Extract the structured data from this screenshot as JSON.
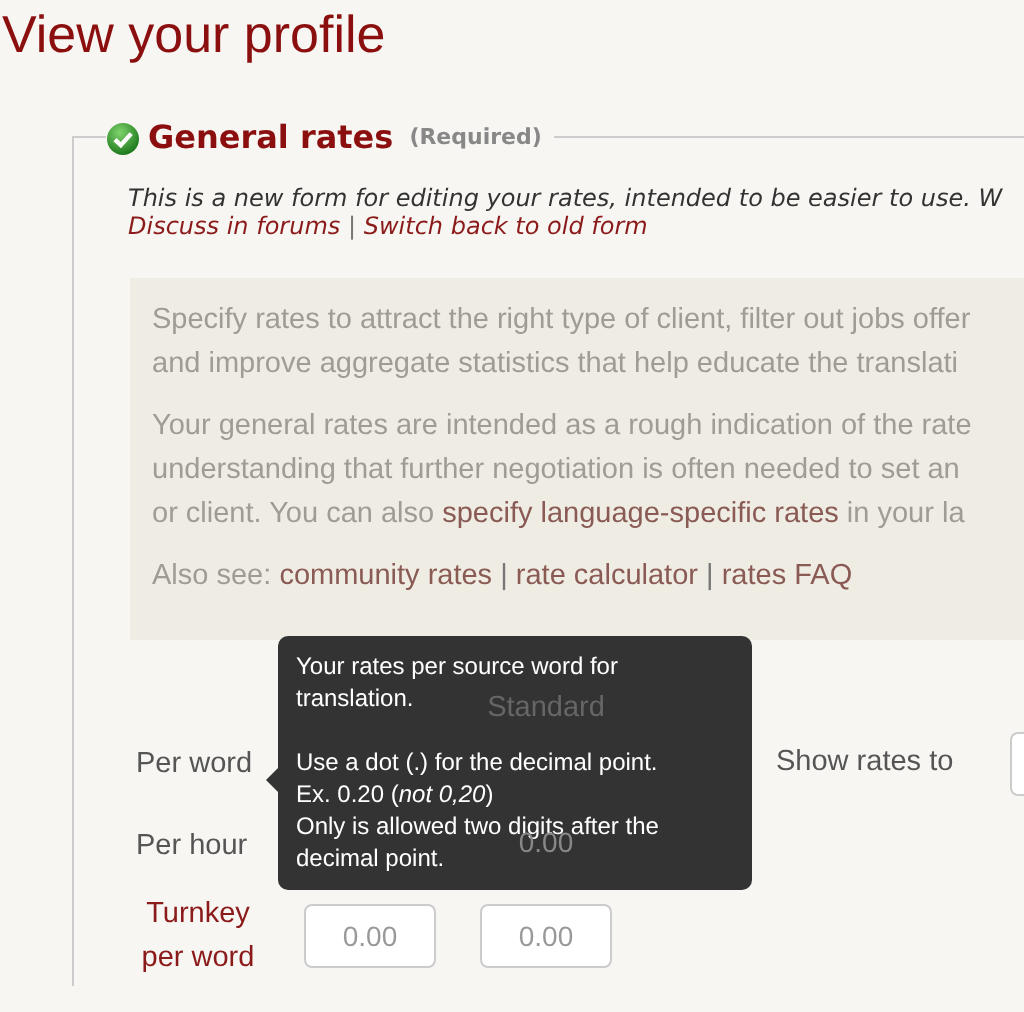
{
  "page_title": "View your profile",
  "section": {
    "title": "General rates",
    "note": "(Required)",
    "complete": true,
    "intro": "This is a new form for editing your rates, intended to be easier to use. W",
    "separator": "|",
    "links": [
      {
        "text": "Discuss in forums"
      },
      {
        "text": "Switch back to old form"
      }
    ]
  },
  "info": {
    "paragraphs": [
      {
        "lines": [
          [
            {
              "text": "Specify rates to attract the right type of client, filter out jobs offer",
              "kind": "text"
            }
          ],
          [
            {
              "text": "and improve aggregate statistics that help educate the translati",
              "kind": "text"
            }
          ]
        ]
      },
      {
        "lines": [
          [
            {
              "text": "Your general rates are intended as a rough indication of the rate",
              "kind": "text"
            }
          ],
          [
            {
              "text": "understanding that further negotiation is often needed to set an",
              "kind": "text"
            }
          ],
          [
            {
              "text": "or client. You can also ",
              "kind": "text"
            },
            {
              "text": "specify language-specific rates",
              "kind": "link"
            },
            {
              "text": " in your la",
              "kind": "text"
            }
          ]
        ]
      }
    ],
    "also_see": {
      "label": "Also see:",
      "separator": "|",
      "links": [
        {
          "text": "community rates"
        },
        {
          "text": "rate calculator"
        },
        {
          "text": "rates FAQ"
        }
      ]
    }
  },
  "rates": {
    "column_headers": {
      "standard": "Standard"
    },
    "rows": [
      {
        "label": "Per word",
        "kind": "plain"
      },
      {
        "label": "Per hour",
        "kind": "plain",
        "standard": "0.00"
      },
      {
        "label": "Turnkey per word",
        "kind": "link",
        "minimum": "0.00",
        "standard": "0.00"
      }
    ],
    "show_rates_label": "Show rates to"
  },
  "tooltip": {
    "paragraphs": [
      [
        "Your rates per source word for",
        "translation."
      ],
      [
        "Use a dot (.) for the decimal point.",
        "Ex. 0.20 (*not 0,20*)",
        "Only is allowed two digits after the",
        "decimal point."
      ]
    ]
  }
}
